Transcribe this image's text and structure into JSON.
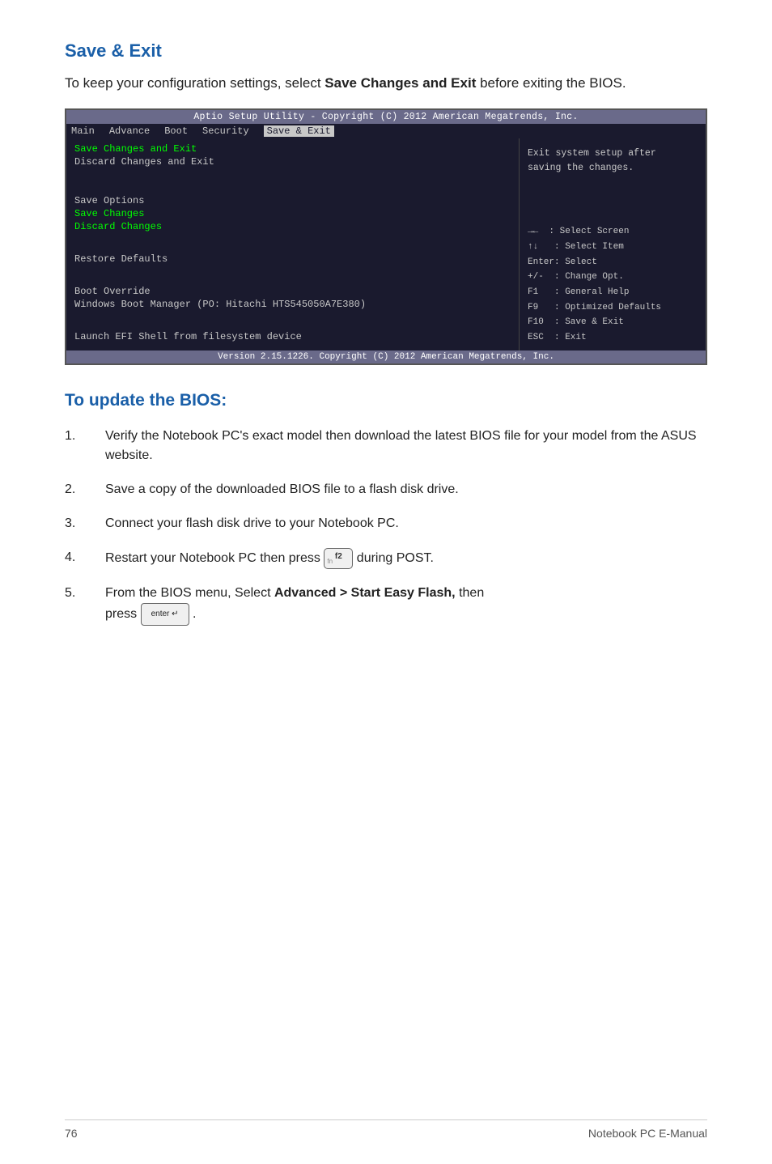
{
  "page": {
    "title": "Save & Exit",
    "intro": "To keep your configuration settings, select ",
    "intro_bold": "Save Changes and Exit",
    "intro_end": " before exiting the BIOS.",
    "bios": {
      "title_bar": "Aptio Setup Utility - Copyright (C) 2012 American Megatrends, Inc.",
      "menu_items": [
        "Main",
        "Advance",
        "Boot",
        "Security",
        "Save & Exit"
      ],
      "active_menu": "Save & Exit",
      "items_highlight": [
        "Save Changes and Exit"
      ],
      "items": [
        "Discard Changes and Exit",
        "",
        "Save Options",
        "Save Changes",
        "Discard Changes",
        "",
        "Restore Defaults",
        "",
        "Boot Override",
        "Windows Boot Manager (PO: Hitachi HTS545050A7E380)",
        "",
        "Launch EFI Shell from filesystem device"
      ],
      "help_text": "Exit system setup after\nsaving the changes.",
      "keys": [
        "→←  : Select Screen",
        "↑↓  : Select Item",
        "Enter: Select",
        "+/-  : Change Opt.",
        "F1   : General Help",
        "F9   : Optimized Defaults",
        "F10  : Save & Exit",
        "ESC  : Exit"
      ],
      "footer": "Version 2.15.1226. Copyright (C) 2012 American Megatrends, Inc."
    },
    "update_title": "To update the BIOS:",
    "steps": [
      {
        "number": "1.",
        "text": "Verify the Notebook PC's exact model then download the latest BIOS file for your model from the ASUS website."
      },
      {
        "number": "2.",
        "text": "Save a copy of the downloaded BIOS file to a flash disk drive."
      },
      {
        "number": "3.",
        "text": "Connect your flash disk drive to your Notebook PC."
      },
      {
        "number": "4.",
        "text_before": "Restart your Notebook PC then press ",
        "has_key_f2": true,
        "text_after": " during POST."
      },
      {
        "number": "5.",
        "text_before": "From the BIOS menu, Select ",
        "bold_text": "Advanced > Start Easy Flash,",
        "text_mid": " then\npress ",
        "has_key_enter": true,
        "text_after": "."
      }
    ],
    "footer": {
      "page_number": "76",
      "label": "Notebook PC E-Manual"
    }
  }
}
